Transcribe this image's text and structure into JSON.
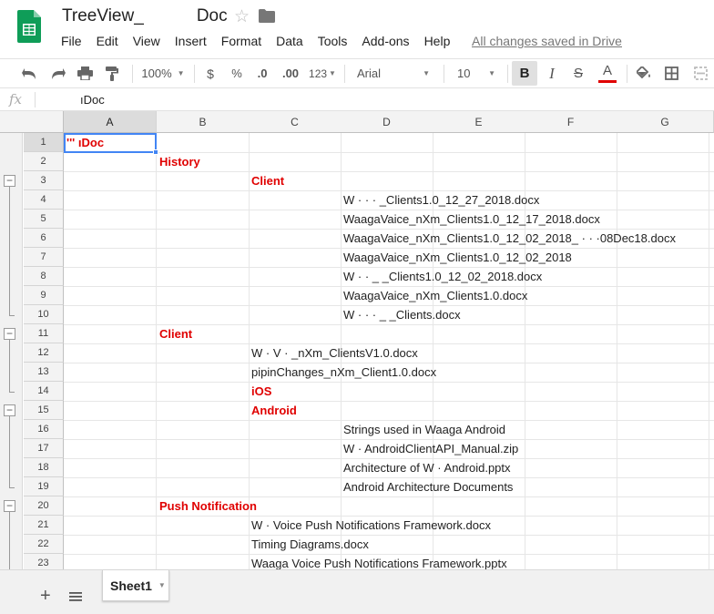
{
  "header": {
    "title": "TreeView_           Doc",
    "menu": [
      "File",
      "Edit",
      "View",
      "Insert",
      "Format",
      "Data",
      "Tools",
      "Add-ons",
      "Help"
    ],
    "save_status": "All changes saved in Drive"
  },
  "toolbar": {
    "zoom": "100%",
    "currency": "$",
    "percent": "%",
    "decrease_decimal": ".0",
    "increase_decimal": ".00",
    "more_formats": "123",
    "font": "Arial",
    "font_size": "10",
    "bold": "B",
    "italic": "I",
    "strike": "S",
    "text_color": "A",
    "text_color_value": "#e00000"
  },
  "formula_bar": {
    "fx": "fx",
    "value": "ıDoc"
  },
  "columns": [
    "A",
    "B",
    "C",
    "D",
    "E",
    "F",
    "G"
  ],
  "rows": [
    {
      "num": "1",
      "col": "A",
      "text": "'''          ıDoc",
      "style": "red"
    },
    {
      "num": "2",
      "col": "B",
      "text": "History",
      "style": "red"
    },
    {
      "num": "3",
      "col": "C",
      "text": "Client",
      "style": "red"
    },
    {
      "num": "4",
      "col": "D",
      "text": "W            ·         ·  ·  _Clients1.0_12_27_2018.docx",
      "style": "normal"
    },
    {
      "num": "5",
      "col": "D",
      "text": "WaagaVaice_nXm_Clients1.0_12_17_2018.docx",
      "style": "normal"
    },
    {
      "num": "6",
      "col": "D",
      "text": "WaagaVaice_nXm_Clients1.0_12_02_2018_  · · ·08Dec18.docx",
      "style": "normal"
    },
    {
      "num": "7",
      "col": "D",
      "text": "WaagaVaice_nXm_Clients1.0_12_02_2018",
      "style": "normal"
    },
    {
      "num": "8",
      "col": "D",
      "text": "W    ·    ·      _  _Clients1.0_12_02_2018.docx",
      "style": "normal"
    },
    {
      "num": "9",
      "col": "D",
      "text": "WaagaVaice_nXm_Clients1.0.docx",
      "style": "normal"
    },
    {
      "num": "10",
      "col": "D",
      "text": "W   ·  ·    ·  _  _Clients.docx",
      "style": "normal"
    },
    {
      "num": "11",
      "col": "B",
      "text": "Client",
      "style": "red"
    },
    {
      "num": "12",
      "col": "C",
      "text": "W    ·  V  ·   _nXm_ClientsV1.0.docx",
      "style": "normal"
    },
    {
      "num": "13",
      "col": "C",
      "text": "pipinChanges_nXm_Client1.0.docx",
      "style": "normal"
    },
    {
      "num": "14",
      "col": "C",
      "text": "iOS",
      "style": "red"
    },
    {
      "num": "15",
      "col": "C",
      "text": "Android",
      "style": "red"
    },
    {
      "num": "16",
      "col": "D",
      "text": "Strings used in Waaga Android",
      "style": "normal"
    },
    {
      "num": "17",
      "col": "D",
      "text": "W    ·  AndroidClientAPI_Manual.zip",
      "style": "normal"
    },
    {
      "num": "18",
      "col": "D",
      "text": "Architecture of W    ·  Android.pptx",
      "style": "normal"
    },
    {
      "num": "19",
      "col": "D",
      "text": "Android Architecture Documents",
      "style": "normal"
    },
    {
      "num": "20",
      "col": "B",
      "text": "Push Notification",
      "style": "red"
    },
    {
      "num": "21",
      "col": "C",
      "text": "W    ·  Voice Push Notifications Framework.docx",
      "style": "normal"
    },
    {
      "num": "22",
      "col": "C",
      "text": "Timing Diagrams.docx",
      "style": "normal"
    },
    {
      "num": "23",
      "col": "C",
      "text": "Waaga Voice Push Notifications Framework.pptx",
      "style": "normal"
    }
  ],
  "sheets": {
    "active": "Sheet1"
  }
}
